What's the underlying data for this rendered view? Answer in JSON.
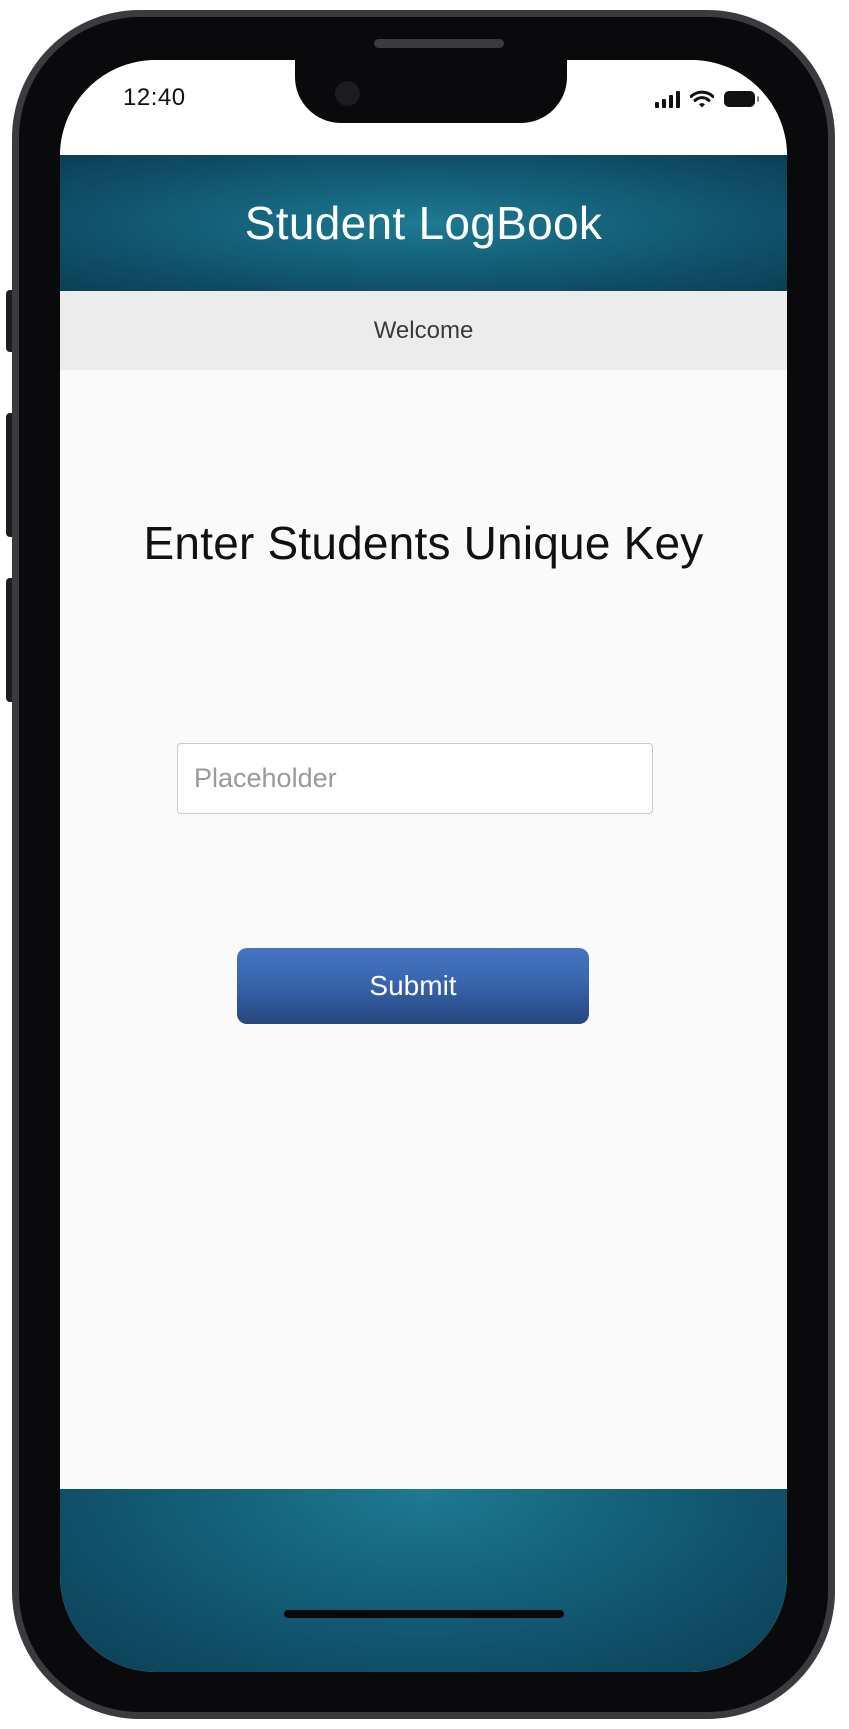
{
  "status_bar": {
    "time": "12:40",
    "icons": [
      "cellular-signal-icon",
      "wifi-icon",
      "battery-icon"
    ]
  },
  "header": {
    "title": "Student LogBook"
  },
  "subheader": {
    "label": "Welcome"
  },
  "main": {
    "prompt": "Enter Students Unique Key",
    "key_input": {
      "value": "",
      "placeholder": "Placeholder"
    },
    "submit_label": "Submit"
  },
  "colors": {
    "header_accent": "#135e77",
    "button_accent": "#3865ad"
  }
}
